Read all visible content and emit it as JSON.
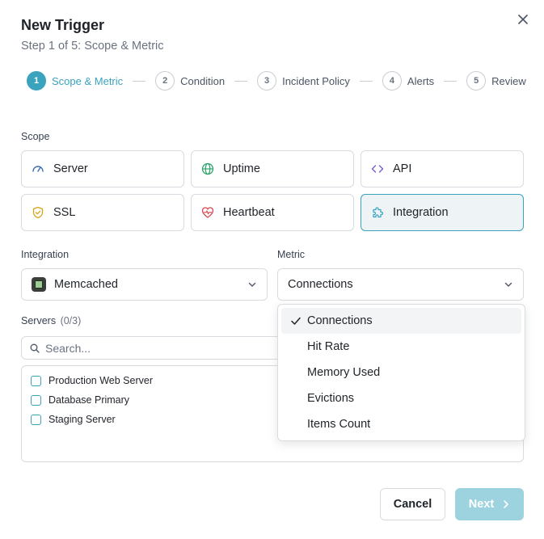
{
  "dialog": {
    "title": "New Trigger",
    "subtitle": "Step 1 of 5: Scope & Metric"
  },
  "steps": [
    {
      "number": "1",
      "label": "Scope & Metric",
      "active": true
    },
    {
      "number": "2",
      "label": "Condition",
      "active": false
    },
    {
      "number": "3",
      "label": "Incident Policy",
      "active": false
    },
    {
      "number": "4",
      "label": "Alerts",
      "active": false
    },
    {
      "number": "5",
      "label": "Review",
      "active": false
    }
  ],
  "scope": {
    "label": "Scope",
    "options": [
      {
        "label": "Server",
        "icon": "gauge-icon",
        "selected": false
      },
      {
        "label": "Uptime",
        "icon": "globe-icon",
        "selected": false
      },
      {
        "label": "API",
        "icon": "code-icon",
        "selected": false
      },
      {
        "label": "SSL",
        "icon": "shield-icon",
        "selected": false
      },
      {
        "label": "Heartbeat",
        "icon": "heart-pulse-icon",
        "selected": false
      },
      {
        "label": "Integration",
        "icon": "puzzle-icon",
        "selected": true
      }
    ]
  },
  "integration": {
    "label": "Integration",
    "value": "Memcached",
    "icon": "memcached-logo-icon"
  },
  "metric": {
    "label": "Metric",
    "value": "Connections",
    "options": [
      "Connections",
      "Hit Rate",
      "Memory Used",
      "Evictions",
      "Items Count"
    ],
    "selected_index": 0
  },
  "servers": {
    "label": "Servers",
    "count": "(0/3)",
    "search_placeholder": "Search...",
    "items": [
      "Production Web Server",
      "Database Primary",
      "Staging Server"
    ]
  },
  "buttons": {
    "cancel": "Cancel",
    "next": "Next"
  },
  "colors": {
    "accent": "#3aa3bd",
    "accent_disabled": "#9dd3df",
    "border": "#d8dbe0",
    "selected_card_bg": "#eef3f6"
  }
}
